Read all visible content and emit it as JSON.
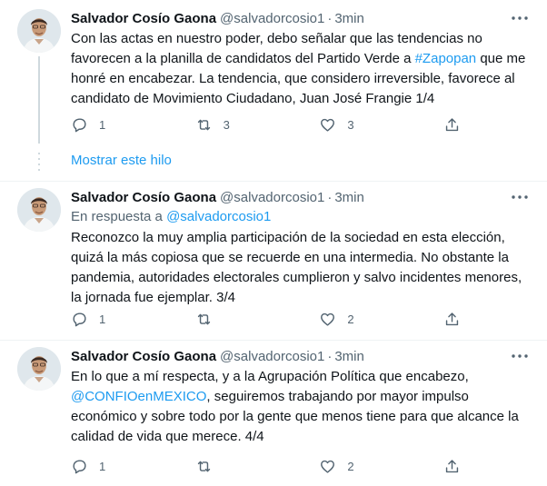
{
  "tweets": [
    {
      "name": "Salvador Cosío Gaona",
      "handle": "@salvadorcosio1",
      "separator": "·",
      "time": "3min",
      "reply_prefix": "",
      "reply_handle": "",
      "text_parts": [
        "Con las actas en nuestro poder, debo señalar que las tendencias no favorecen a la planilla de candidatos del Partido Verde a ",
        "#Zapopan",
        " que me honré en encabezar. La tendencia, que considero irreversible, favorece al candidato de Movimiento Ciudadano, Juan José Frangie 1/4"
      ],
      "replies": "1",
      "retweets": "3",
      "likes": "3"
    },
    {
      "name": "Salvador Cosío Gaona",
      "handle": "@salvadorcosio1",
      "separator": "·",
      "time": "3min",
      "reply_prefix": "En respuesta a ",
      "reply_handle": "@salvadorcosio1",
      "text_parts": [
        "Reconozco la muy amplia participación de la sociedad en esta elección, quizá la más copiosa que se recuerde en una intermedia. No obstante la pandemia, autoridades electorales cumplieron y salvo incidentes menores, la jornada fue ejemplar. 3/4",
        "",
        ""
      ],
      "replies": "1",
      "retweets": "",
      "likes": "2"
    },
    {
      "name": "Salvador Cosío Gaona",
      "handle": "@salvadorcosio1",
      "separator": "·",
      "time": "3min",
      "reply_prefix": "",
      "reply_handle": "",
      "text_parts": [
        "En lo que a mí respecta, y a la Agrupación Política que encabezo, ",
        "@CONFIOenMEXICO",
        ", seguiremos trabajando por mayor impulso económico y sobre todo por la gente que menos tiene para que alcance la calidad de vida que merece. 4/4"
      ],
      "replies": "1",
      "retweets": "",
      "likes": "2"
    }
  ],
  "thread": {
    "show_label": "Mostrar este hilo"
  },
  "icons": {
    "reply": "reply-icon",
    "retweet": "retweet-icon",
    "like": "like-icon",
    "share": "share-icon",
    "more": "more-icon"
  },
  "colors": {
    "link": "#1d9bf0",
    "secondary": "#536471",
    "text": "#0f1419",
    "divider": "#eff3f4"
  }
}
